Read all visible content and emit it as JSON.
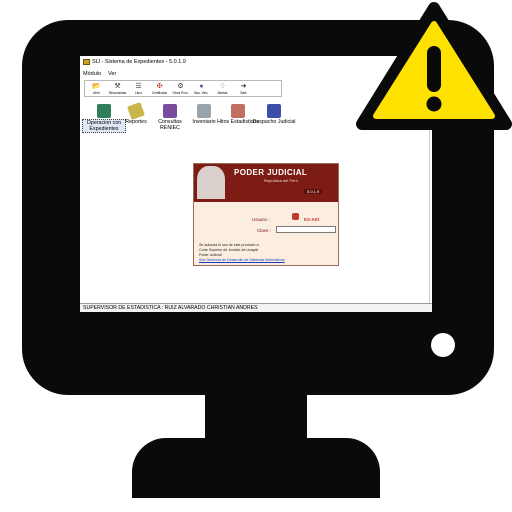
{
  "window": {
    "title": "SIJ - Sistema de Expedientes - 5.0.1.9"
  },
  "menubar": {
    "items": [
      "Módulo",
      "Ver"
    ]
  },
  "toolbar": {
    "items": [
      {
        "label": "Abrir",
        "icon": "folder-open-icon"
      },
      {
        "label": "Reconsultas",
        "icon": "gavel-icon"
      },
      {
        "label": "Libro",
        "icon": "book-icon"
      },
      {
        "label": "Certificado",
        "icon": "certificate-icon"
      },
      {
        "label": "Otros Proc.",
        "icon": "process-icon"
      },
      {
        "label": "Bus. Vinc.",
        "icon": "link-search-icon"
      },
      {
        "label": "Alertas",
        "icon": "bell-icon"
      },
      {
        "label": "Salir",
        "icon": "exit-icon"
      }
    ]
  },
  "modules": [
    {
      "label": "Operacion con Expedientes",
      "icon": "expedientes-icon",
      "color": "#2e7d5b",
      "selected": true
    },
    {
      "label": "Reportes",
      "icon": "reportes-icon",
      "color": "#c9b54a",
      "selected": false
    },
    {
      "label": "Consultas RENIEC",
      "icon": "reniec-icon",
      "color": "#7a4c9e",
      "selected": false
    },
    {
      "label": "Inventario",
      "icon": "inventario-icon",
      "color": "#9aa4ad",
      "selected": false
    },
    {
      "label": "Hitos Estadisticos",
      "icon": "hitos-icon",
      "color": "#c07060",
      "selected": false
    },
    {
      "label": "Despacho Judicial",
      "icon": "despacho-icon",
      "color": "#3b4fa8",
      "selected": false
    }
  ],
  "login": {
    "title": "PODER JUDICIAL",
    "subtitle": "República del Perú",
    "version": "5.0.1.9",
    "usuario_label": "Usuario :",
    "usuario_value": "ES-AIO",
    "clave_label": "Clave :",
    "clave_value": "",
    "notice_line1": "Se autoriza el uso de este producto a:",
    "notice_line2": "Corte Superior de Justicia de Ucayali",
    "notice_line3": "Poder Judicial",
    "notice_link": "Sub Gerencia de Desarrollo de Sistemas Informaticos"
  },
  "statusbar": {
    "text": "SUPERVISOR DE ESTADISTICA : RUIZ ALVARADO CHRISTIAN ANDRES"
  },
  "colors": {
    "monitor": "#0a0a0a",
    "warning_fill": "#ffe100",
    "warning_stroke": "#0a0a0a",
    "banner": "#7c1c14",
    "login_bg": "#fbeee0"
  },
  "icons": {
    "warning": "warning-triangle-icon",
    "power": "power-indicator-icon"
  }
}
